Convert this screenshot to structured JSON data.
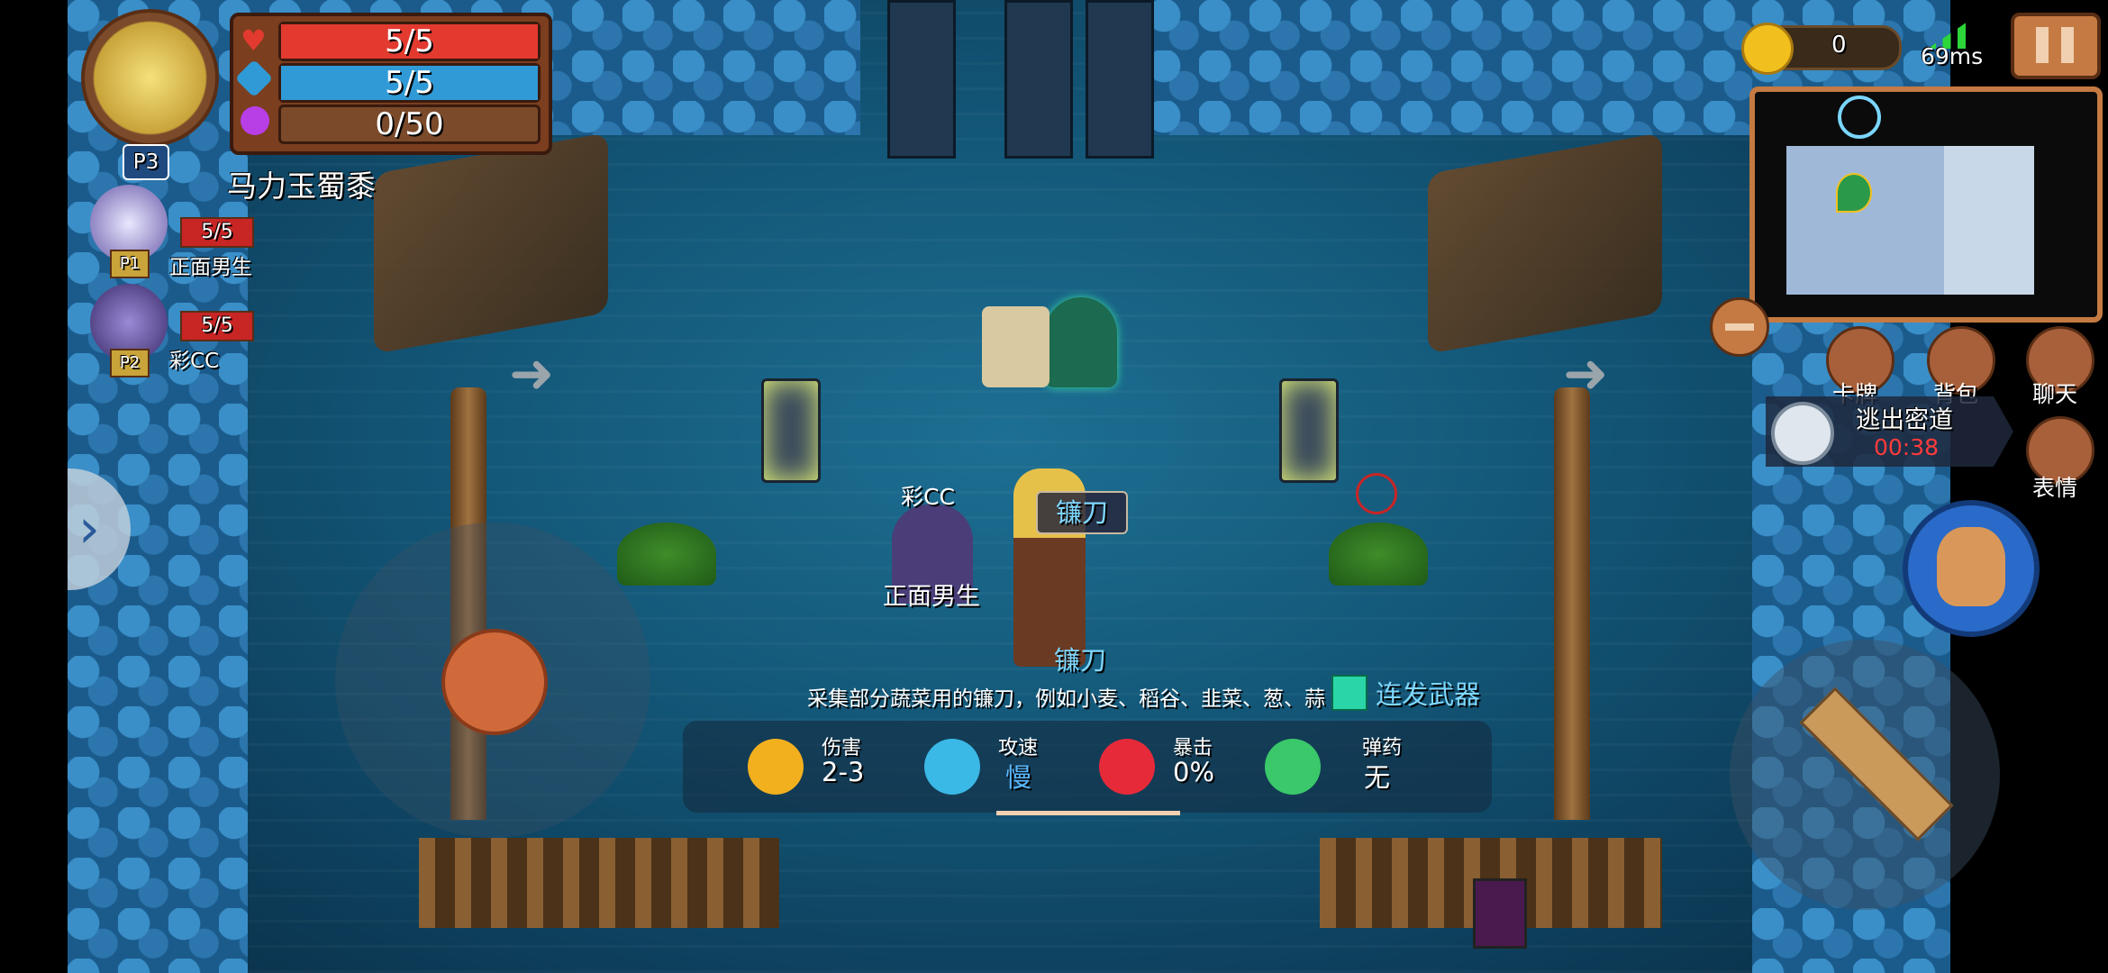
{
  "player": {
    "name": "马力玉蜀黍",
    "tag": "P3",
    "hp": "5/5",
    "shield": "5/5",
    "energy": "0/50",
    "hp_fraction": 1.0,
    "shield_fraction": 1.0,
    "energy_fraction": 0.0
  },
  "teammates": [
    {
      "tag": "P1",
      "hp": "5/5",
      "name": "正面男生"
    },
    {
      "tag": "P2",
      "hp": "5/5",
      "name": "彩CC"
    }
  ],
  "top_right": {
    "coins": "0",
    "ping": "69ms"
  },
  "menu": {
    "cards": "卡牌",
    "backpack": "背包",
    "chat": "聊天",
    "emote": "表情"
  },
  "quest": {
    "title": "逃出密道",
    "timer": "00:38"
  },
  "world_labels": {
    "npc_caicc": "彩CC",
    "npc_zhengmian": "正面男生",
    "weapon_tag_top": "镰刀",
    "weapon_tag_bottom": "镰刀"
  },
  "weapon_panel": {
    "description": "采集部分蔬菜用的镰刀，例如小麦、稻谷、韭菜、葱、蒜",
    "type": "连发武器",
    "stats": [
      {
        "label": "伤害",
        "value": "2-3",
        "icon": "damage-icon"
      },
      {
        "label": "攻速",
        "value": "慢",
        "icon": "speed-icon"
      },
      {
        "label": "暴击",
        "value": "0%",
        "icon": "crit-icon"
      },
      {
        "label": "弹药",
        "value": "无",
        "icon": "ammo-icon"
      }
    ]
  },
  "colors": {
    "hp": "#e23a2f",
    "shield": "#2f9ad6",
    "energy": "#7a4a2a",
    "timer": "#ff3b3b",
    "accent": "#d07a3a"
  }
}
